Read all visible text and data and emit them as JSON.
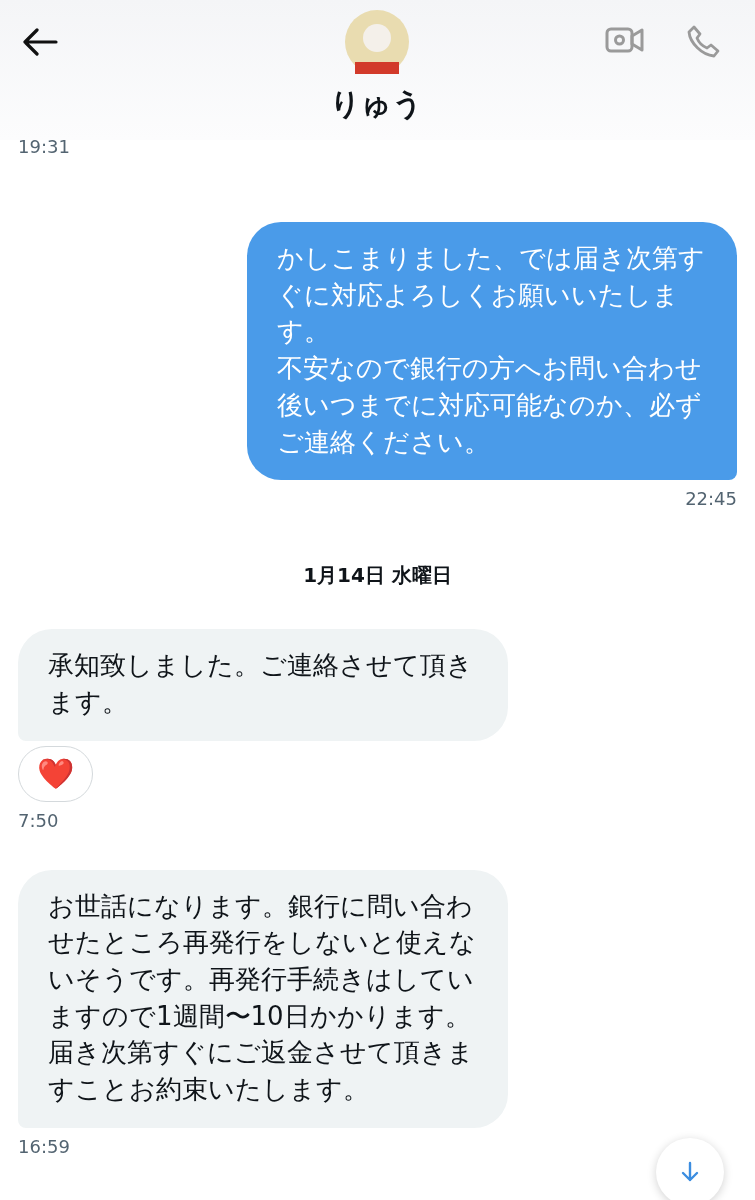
{
  "header": {
    "name": "りゅう"
  },
  "items": [
    {
      "kind": "received_time",
      "text": "19:31"
    },
    {
      "kind": "sent_message",
      "paragraphs": [
        "かしこまりました、では届き次第すぐに対応よろしくお願いいたします。",
        "不安なので銀行の方へお問い合わせ後いつまでに対応可能なのか、必ずご連絡ください。"
      ]
    },
    {
      "kind": "sent_time",
      "text": "22:45"
    },
    {
      "kind": "date",
      "text": "1月14日 水曜日"
    },
    {
      "kind": "received_message",
      "paragraphs": [
        "承知致しました。ご連絡させて頂きます。"
      ]
    },
    {
      "kind": "reaction",
      "text": "❤️"
    },
    {
      "kind": "received_time",
      "text": "7:50"
    },
    {
      "kind": "received_message",
      "paragraphs": [
        "お世話になります。銀行に問い合わせたところ再発行をしないと使えないそうです。再発行手続きはしていますので1週間〜10日かかります。届き次第すぐにご返金させて頂きますことお約束いたします。"
      ]
    },
    {
      "kind": "received_time",
      "text": "16:59"
    }
  ]
}
